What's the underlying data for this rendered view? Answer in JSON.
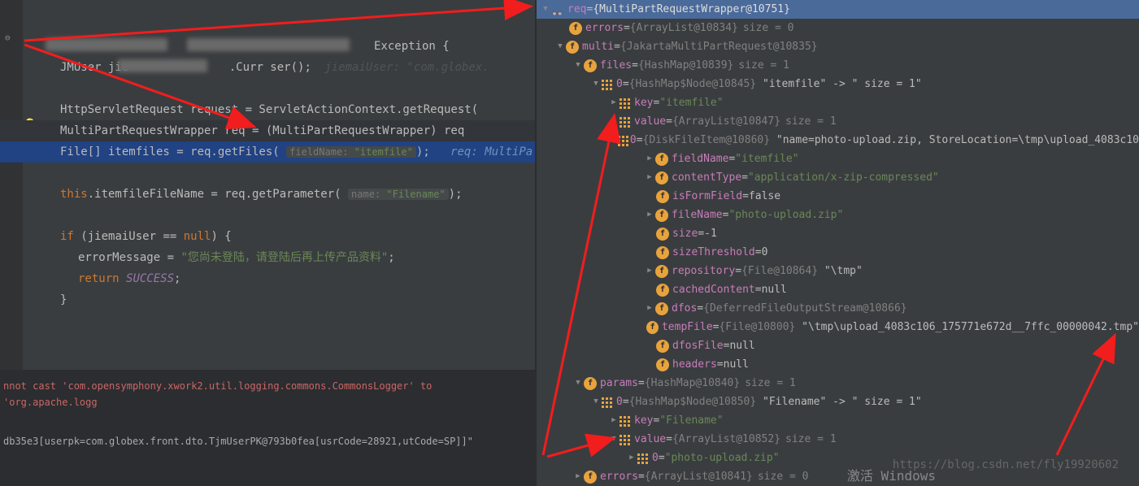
{
  "code": {
    "line2_typehint": "Exception {",
    "line3_a": "JMUser jie",
    "line3_b": ".Curr       ser();",
    "line3_hint": "jiemaiUser: \"com.globex.",
    "line5": "HttpServletRequest request = ServletActionContext.getRequest(",
    "line6": "MultiPartRequestWrapper req = (MultiPartRequestWrapper) req",
    "line7_a": "File[] itemfiles = req.getFiles(",
    "line7_hint": "fieldName:",
    "line7_val": "\"itemfile\"",
    "line7_tail": ");",
    "line7_comment": "req: MultiPa",
    "line9_a": "this",
    "line9_b": ".itemfileFileName = req.getParameter(",
    "line9_hint": "name:",
    "line9_val": "\"Filename\"",
    "line9_tail": ");",
    "line11_a": "if (jiemaiUser == ",
    "line11_b": "null",
    "line11_c": ") {",
    "line12_a": "errorMessage = ",
    "line12_b": "\"您尚未登陆，请登陆后再上传产品资料\"",
    "line12_c": ";",
    "line13_a": "return ",
    "line13_b": "SUCCESS",
    "line13_c": ";",
    "line14": "}"
  },
  "console": {
    "err": "nnot cast 'com.opensymphony.xwork2.util.logging.commons.CommonsLogger' to 'org.apache.logg",
    "info": "db35e3[userpk=com.globex.front.dto.TjmUserPK@793b0fea[usrCode=28921,utCode=SP]]\""
  },
  "tree": {
    "root": {
      "name": "req",
      "val": "{MultiPartRequestWrapper@10751}"
    },
    "errors1": {
      "name": "errors",
      "val": "{ArrayList@10834}",
      "size": "size = 0"
    },
    "multi": {
      "name": "multi",
      "val": "{JakartaMultiPartRequest@10835}"
    },
    "files": {
      "name": "files",
      "val": "{HashMap@10839}",
      "size": "size = 1"
    },
    "node0": {
      "name": "0",
      "val": "{HashMap$Node@10845}",
      "str": "\"itemfile\" -> \" size = 1\""
    },
    "key1": {
      "name": "key",
      "val": "\"itemfile\""
    },
    "value1": {
      "name": "value",
      "val": "{ArrayList@10847}",
      "size": "size = 1"
    },
    "item0": {
      "name": "0",
      "val": "{DiskFileItem@10860}",
      "str": "\"name=photo-upload.zip, StoreLocation=\\tmp\\upload_4083c10"
    },
    "fieldName": {
      "name": "fieldName",
      "val": "\"itemfile\""
    },
    "contentType": {
      "name": "contentType",
      "val": "\"application/x-zip-compressed\""
    },
    "isFormField": {
      "name": "isFormField",
      "val": "false"
    },
    "fileName": {
      "name": "fileName",
      "val": "\"photo-upload.zip\""
    },
    "filesize": {
      "name": "size",
      "val": "-1"
    },
    "sizeThreshold": {
      "name": "sizeThreshold",
      "val": "0"
    },
    "repository": {
      "name": "repository",
      "val": "{File@10864}",
      "str": "\"\\tmp\""
    },
    "cachedContent": {
      "name": "cachedContent",
      "val": "null"
    },
    "dfos": {
      "name": "dfos",
      "val": "{DeferredFileOutputStream@10866}"
    },
    "tempFile": {
      "name": "tempFile",
      "val": "{File@10800}",
      "str": "\"\\tmp\\upload_4083c106_175771e672d__7ffc_00000042.tmp\""
    },
    "dfosFile": {
      "name": "dfosFile",
      "val": "null"
    },
    "headers": {
      "name": "headers",
      "val": "null"
    },
    "params": {
      "name": "params",
      "val": "{HashMap@10840}",
      "size": "size = 1"
    },
    "pnode0": {
      "name": "0",
      "val": "{HashMap$Node@10850}",
      "str": "\"Filename\" -> \" size = 1\""
    },
    "pkey": {
      "name": "key",
      "val": "\"Filename\""
    },
    "pvalue": {
      "name": "value",
      "val": "{ArrayList@10852}",
      "size": "size = 1"
    },
    "pitem0": {
      "name": "0",
      "val": "\"photo-upload.zip\""
    },
    "errors2": {
      "name": "errors",
      "val": "{ArrayList@10841}",
      "size": "size = 0"
    }
  },
  "watermark": "https://blog.csdn.net/fly19920602",
  "wintext": "激活 Windows"
}
